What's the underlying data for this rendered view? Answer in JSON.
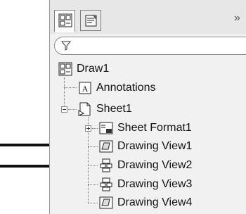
{
  "tabs": [
    {
      "name": "feature-manager-tab",
      "icon": "feature-tree-icon"
    },
    {
      "name": "property-manager-tab",
      "icon": "property-icon"
    }
  ],
  "more_label": "»",
  "filter": {
    "icon": "filter-icon",
    "value": ""
  },
  "tree": {
    "root": {
      "label": "Draw1",
      "icon": "drawing-icon"
    },
    "annotations": {
      "label": "Annotations",
      "icon": "annotation-icon"
    },
    "sheet": {
      "label": "Sheet1",
      "icon": "sheet-icon"
    },
    "sheet_format": {
      "label": "Sheet Format1",
      "icon": "sheet-format-icon"
    },
    "views": [
      {
        "label": "Drawing View1",
        "icon": "drawing-view-icon"
      },
      {
        "label": "Drawing View2",
        "icon": "section-view-icon"
      },
      {
        "label": "Drawing View3",
        "icon": "section-view-icon"
      },
      {
        "label": "Drawing View4",
        "icon": "drawing-view-icon"
      }
    ]
  },
  "callout_arrows": {
    "count": 2,
    "color": "#111111"
  }
}
